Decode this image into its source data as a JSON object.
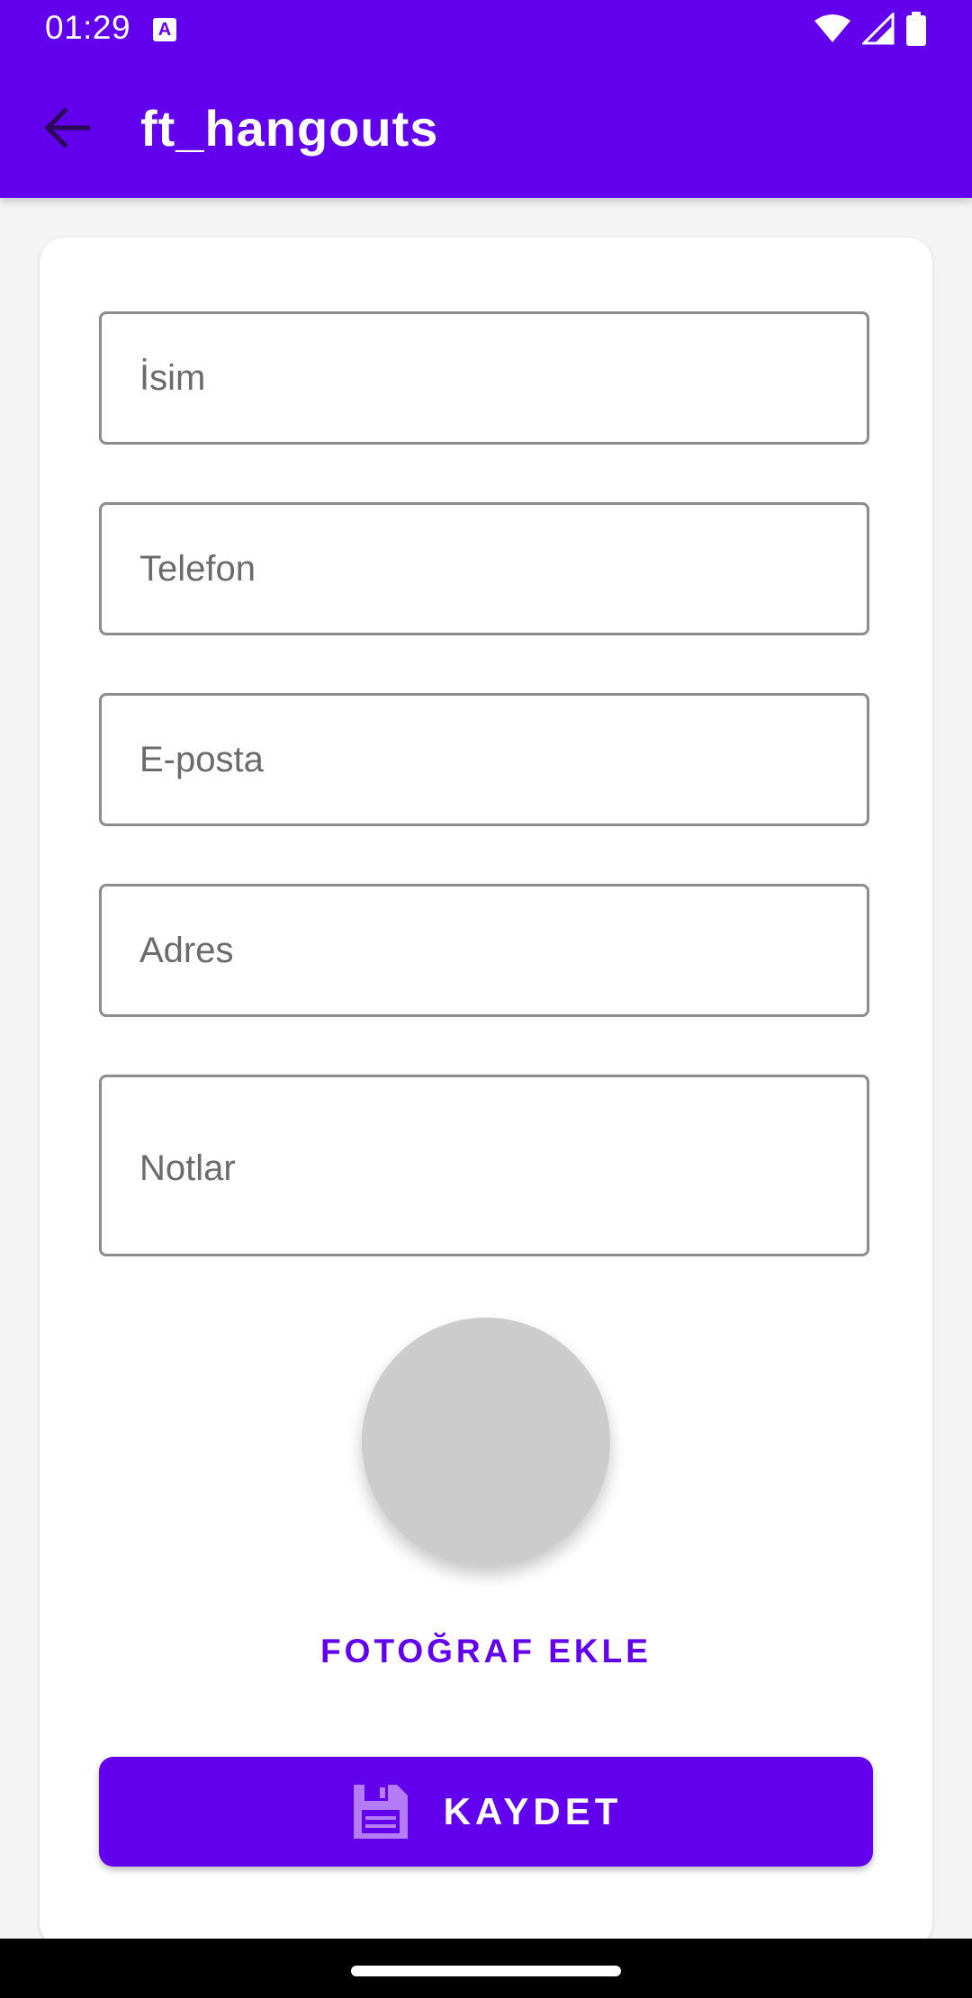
{
  "status_bar": {
    "time": "01:29",
    "notification_icon": "keyboard-a-icon",
    "notification_letter": "A",
    "icons": [
      "wifi-icon",
      "cellular-signal-icon",
      "battery-icon"
    ]
  },
  "app_bar": {
    "title": "ft_hangouts",
    "back_icon": "arrow-left-icon"
  },
  "form": {
    "fields": [
      {
        "name": "name",
        "placeholder": "İsim",
        "value": ""
      },
      {
        "name": "phone",
        "placeholder": "Telefon",
        "value": ""
      },
      {
        "name": "email",
        "placeholder": "E-posta",
        "value": ""
      },
      {
        "name": "address",
        "placeholder": "Adres",
        "value": ""
      },
      {
        "name": "notes",
        "placeholder": "Notlar",
        "value": ""
      }
    ],
    "add_photo_label": "FOTOĞRAF EKLE",
    "save_label": "KAYDET",
    "save_icon": "floppy-disk-icon"
  },
  "colors": {
    "primary": "#6200ee",
    "avatar_placeholder": "#cccccc",
    "save_icon": "#b57cf7",
    "background": "#f4f4f4"
  }
}
